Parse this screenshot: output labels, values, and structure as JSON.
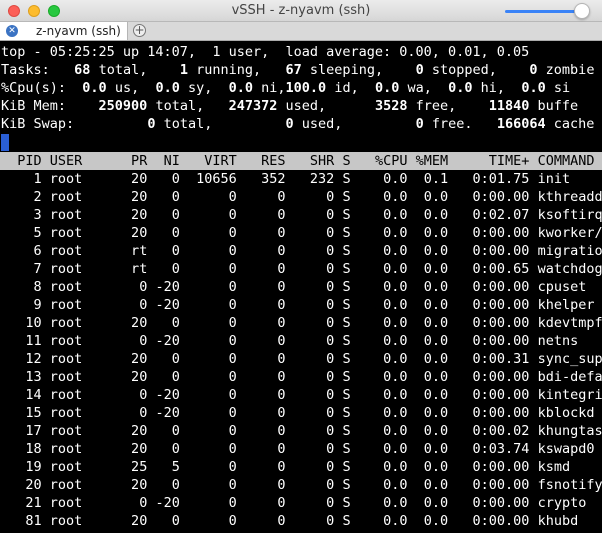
{
  "window": {
    "title": "vSSH - z-nyavm (ssh)",
    "font_size_slider_level": 0.9
  },
  "tabs": [
    {
      "label": "z-nyavm (ssh)",
      "active": true
    }
  ],
  "tab_add_glyph": "+",
  "tab_close_glyph": "✕",
  "summary": {
    "uptime_line": "top - 05:25:25 up 14:07,  1 user,  load average: 0.00, 0.01, 0.05",
    "tasks": {
      "label": "Tasks:",
      "total": "68",
      "running": "1",
      "sleeping": "67",
      "stopped": "0",
      "zombie": "0"
    },
    "cpu": {
      "label": "%Cpu(s):",
      "us": "0.0",
      "sy": "0.0",
      "ni": "0.0",
      "id": "100.0",
      "wa": "0.0",
      "hi": "0.0",
      "si": "0.0"
    },
    "mem": {
      "label": "KiB Mem:",
      "total": "250900",
      "used": "247372",
      "free": "3528",
      "buffers": "11840",
      "buffers_label": "buffe"
    },
    "swap": {
      "label": "KiB Swap:",
      "total": "0",
      "used": "0",
      "free": "0",
      "cached": "166064",
      "cached_label": "cache"
    }
  },
  "columns": [
    "PID",
    "USER",
    "PR",
    "NI",
    "VIRT",
    "RES",
    "SHR",
    "S",
    "%CPU",
    "%MEM",
    "TIME+",
    "COMMAND"
  ],
  "processes": [
    [
      "1",
      "root",
      "20",
      "0",
      "10656",
      "352",
      "232",
      "S",
      "0.0",
      "0.1",
      "0:01.75",
      "init"
    ],
    [
      "2",
      "root",
      "20",
      "0",
      "0",
      "0",
      "0",
      "S",
      "0.0",
      "0.0",
      "0:00.00",
      "kthreadd"
    ],
    [
      "3",
      "root",
      "20",
      "0",
      "0",
      "0",
      "0",
      "S",
      "0.0",
      "0.0",
      "0:02.07",
      "ksoftirq"
    ],
    [
      "5",
      "root",
      "20",
      "0",
      "0",
      "0",
      "0",
      "S",
      "0.0",
      "0.0",
      "0:00.00",
      "kworker/"
    ],
    [
      "6",
      "root",
      "rt",
      "0",
      "0",
      "0",
      "0",
      "S",
      "0.0",
      "0.0",
      "0:00.00",
      "migratio"
    ],
    [
      "7",
      "root",
      "rt",
      "0",
      "0",
      "0",
      "0",
      "S",
      "0.0",
      "0.0",
      "0:00.65",
      "watchdog"
    ],
    [
      "8",
      "root",
      "0",
      "-20",
      "0",
      "0",
      "0",
      "S",
      "0.0",
      "0.0",
      "0:00.00",
      "cpuset"
    ],
    [
      "9",
      "root",
      "0",
      "-20",
      "0",
      "0",
      "0",
      "S",
      "0.0",
      "0.0",
      "0:00.00",
      "khelper"
    ],
    [
      "10",
      "root",
      "20",
      "0",
      "0",
      "0",
      "0",
      "S",
      "0.0",
      "0.0",
      "0:00.00",
      "kdevtmpf"
    ],
    [
      "11",
      "root",
      "0",
      "-20",
      "0",
      "0",
      "0",
      "S",
      "0.0",
      "0.0",
      "0:00.00",
      "netns"
    ],
    [
      "12",
      "root",
      "20",
      "0",
      "0",
      "0",
      "0",
      "S",
      "0.0",
      "0.0",
      "0:00.31",
      "sync_sup"
    ],
    [
      "13",
      "root",
      "20",
      "0",
      "0",
      "0",
      "0",
      "S",
      "0.0",
      "0.0",
      "0:00.00",
      "bdi-defa"
    ],
    [
      "14",
      "root",
      "0",
      "-20",
      "0",
      "0",
      "0",
      "S",
      "0.0",
      "0.0",
      "0:00.00",
      "kintegri"
    ],
    [
      "15",
      "root",
      "0",
      "-20",
      "0",
      "0",
      "0",
      "S",
      "0.0",
      "0.0",
      "0:00.00",
      "kblockd"
    ],
    [
      "17",
      "root",
      "20",
      "0",
      "0",
      "0",
      "0",
      "S",
      "0.0",
      "0.0",
      "0:00.02",
      "khungtas"
    ],
    [
      "18",
      "root",
      "20",
      "0",
      "0",
      "0",
      "0",
      "S",
      "0.0",
      "0.0",
      "0:03.74",
      "kswapd0"
    ],
    [
      "19",
      "root",
      "25",
      "5",
      "0",
      "0",
      "0",
      "S",
      "0.0",
      "0.0",
      "0:00.00",
      "ksmd"
    ],
    [
      "20",
      "root",
      "20",
      "0",
      "0",
      "0",
      "0",
      "S",
      "0.0",
      "0.0",
      "0:00.00",
      "fsnotify"
    ],
    [
      "21",
      "root",
      "0",
      "-20",
      "0",
      "0",
      "0",
      "S",
      "0.0",
      "0.0",
      "0:00.00",
      "crypto"
    ],
    [
      "81",
      "root",
      "20",
      "0",
      "0",
      "0",
      "0",
      "S",
      "0.0",
      "0.0",
      "0:00.00",
      "khubd"
    ]
  ],
  "colors": {
    "terminal_bg": "#000000",
    "terminal_fg": "#ffffff",
    "header_bar": "#c7c7c7",
    "cursor": "#2a5fd6"
  }
}
